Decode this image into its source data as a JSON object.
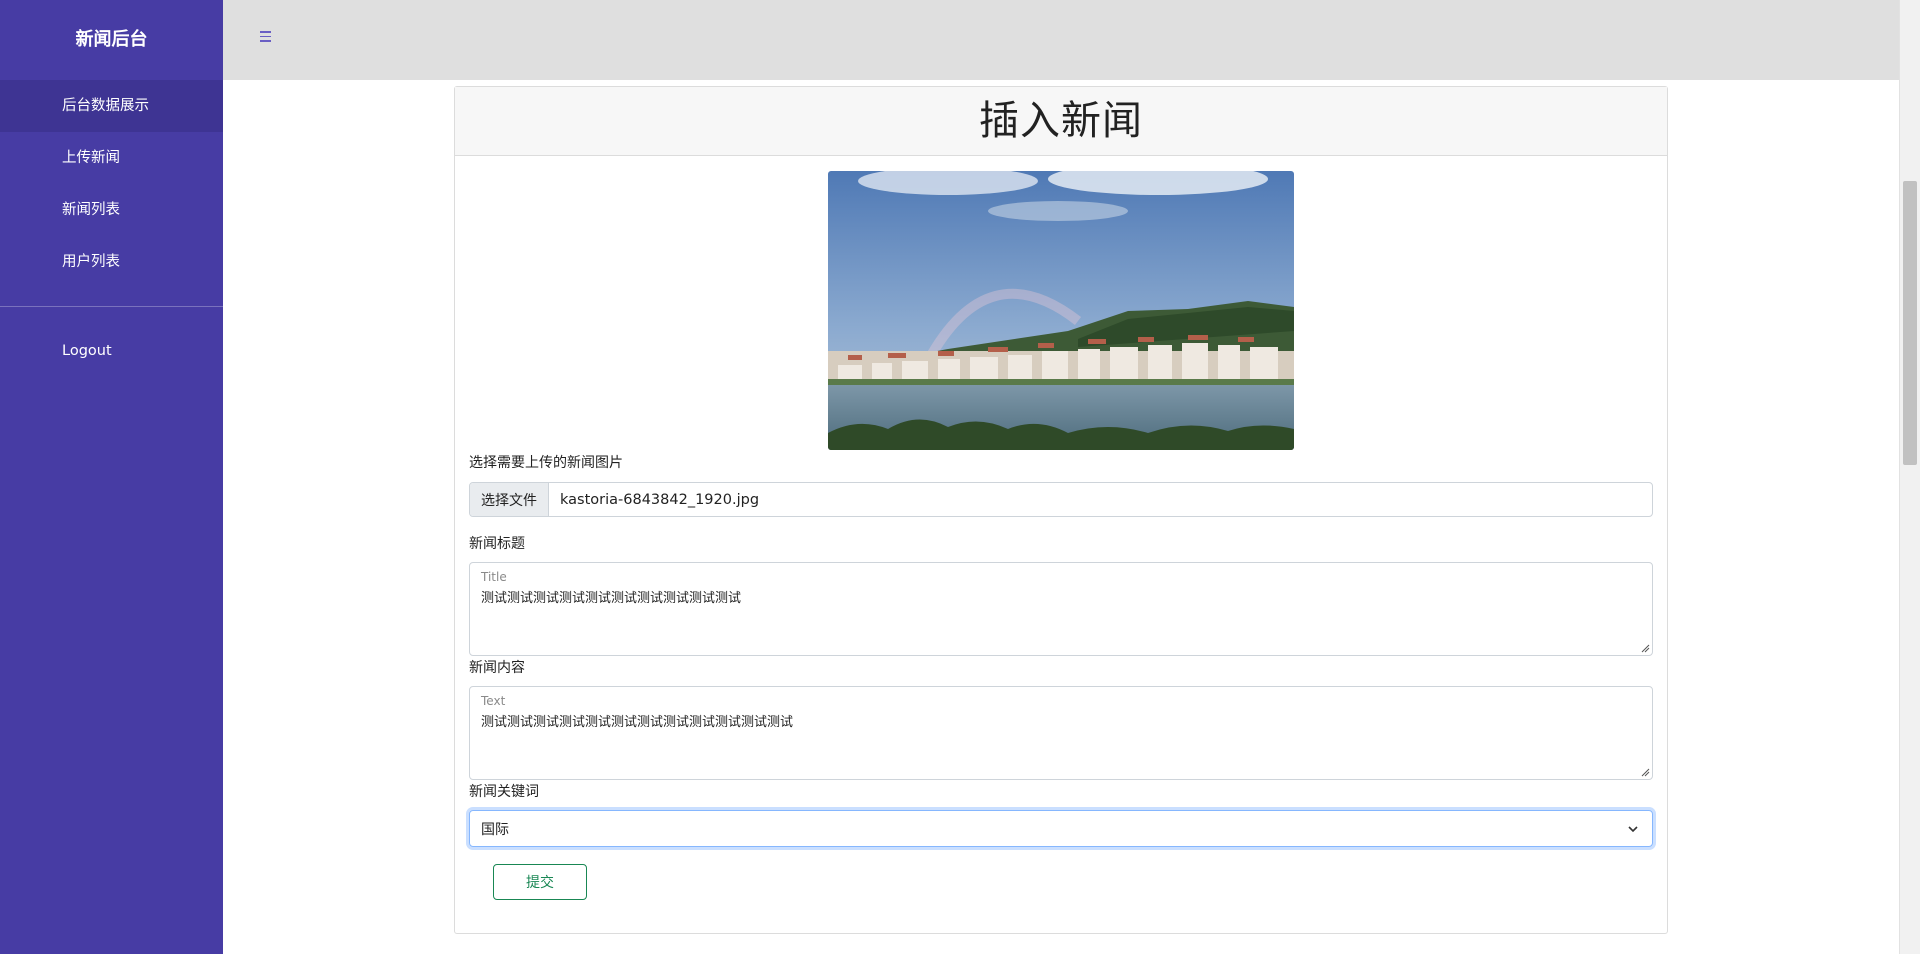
{
  "sidebar": {
    "brand": "新闻后台",
    "items": [
      {
        "label": "后台数据展示",
        "active": true
      },
      {
        "label": "上传新闻"
      },
      {
        "label": "新闻列表"
      },
      {
        "label": "用户列表"
      }
    ],
    "logout_label": "Logout"
  },
  "topbar": {
    "menu_icon": "hamburger-menu-icon"
  },
  "form": {
    "title": "插入新闻",
    "image_label": "选择需要上传的新闻图片",
    "file_button_label": "选择文件",
    "file_name": "kastoria-6843842_1920.jpg",
    "news_title_label": "新闻标题",
    "title_float_label": "Title",
    "title_value": "测试测试测试测试测试测试测试测试测试测试",
    "content_label": "新闻内容",
    "content_float_label": "Text",
    "content_value": "测试测试测试测试测试测试测试测试测试测试测试测试",
    "keyword_label": "新闻关键词",
    "keyword_selected": "国际",
    "submit_label": "提交"
  },
  "colors": {
    "sidebar_bg": "#473ca4",
    "sidebar_active": "#3e3493",
    "topbar_bg": "#dfdfdf",
    "submit_accent": "#198754",
    "focus_border": "#86b7fe"
  }
}
